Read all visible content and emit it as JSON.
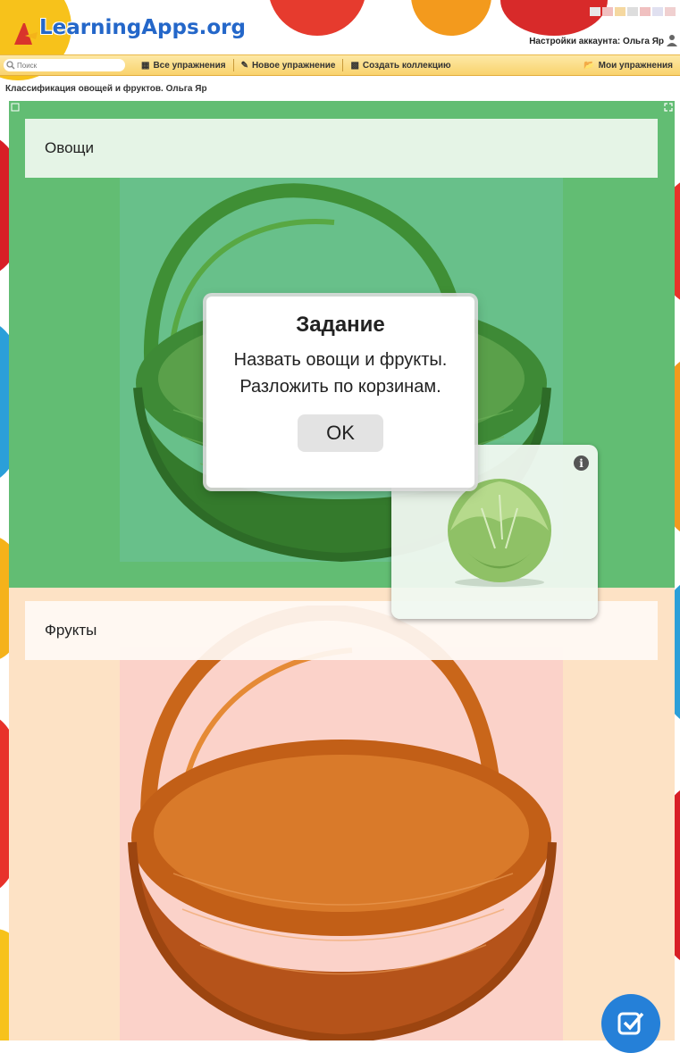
{
  "site": {
    "logo_text": "LearningApps.org"
  },
  "account": {
    "label": "Настройки аккаунта: Ольга Яр"
  },
  "toolbar": {
    "search_placeholder": "Поиск",
    "all_exercises": "Все упражнения",
    "new_exercise": "Новое упражнение",
    "create_collection": "Создать коллекцию",
    "my_exercises": "Мои упражнения"
  },
  "breadcrumb": "Классификация овощей и фруктов. Ольга Яр",
  "zones": {
    "vegetables": {
      "label": "Овощи",
      "color": "#62bd73"
    },
    "fruits": {
      "label": "Фрукты",
      "color": "#fde2c5"
    }
  },
  "modal": {
    "title": "Задание",
    "text": "Назвать овощи и фрукты. Разложить по корзинам.",
    "ok_label": "OK"
  },
  "card": {
    "icon": "info-icon",
    "image": "cabbage"
  },
  "colors": {
    "toolbar": "#f9d36d",
    "brand_blue": "#2467c9",
    "check_button": "#2580d8"
  }
}
